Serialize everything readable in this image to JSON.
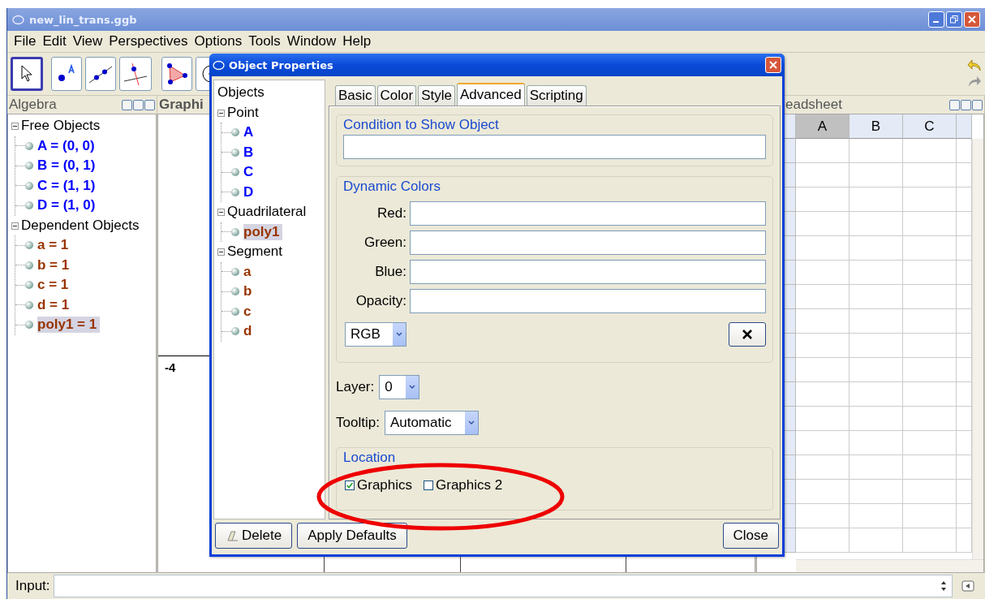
{
  "window": {
    "title": "new_lin_trans.ggb"
  },
  "menu": [
    "File",
    "Edit",
    "View",
    "Perspectives",
    "Options",
    "Tools",
    "Window",
    "Help"
  ],
  "toolbar": [
    {
      "kind": "move",
      "selected": true
    },
    {
      "kind": "point",
      "selected": false
    },
    {
      "kind": "line",
      "selected": false
    },
    {
      "kind": "perpendicular",
      "selected": false
    },
    {
      "kind": "polygon",
      "selected": false
    },
    {
      "kind": "circle",
      "selected": false
    }
  ],
  "algebra": {
    "title": "Algebra",
    "groups": [
      {
        "label": "Free Objects",
        "expanded": true,
        "children": [
          {
            "label": "A = (0, 0)",
            "color": "#0000ff",
            "selected": false
          },
          {
            "label": "B = (0, 1)",
            "color": "#0000ff",
            "selected": false
          },
          {
            "label": "C = (1, 1)",
            "color": "#0000ff",
            "selected": false
          },
          {
            "label": "D = (1, 0)",
            "color": "#0000ff",
            "selected": false
          }
        ]
      },
      {
        "label": "Dependent Objects",
        "expanded": true,
        "children": [
          {
            "label": "a = 1",
            "color": "#993300",
            "selected": false
          },
          {
            "label": "b = 1",
            "color": "#993300",
            "selected": false
          },
          {
            "label": "c = 1",
            "color": "#993300",
            "selected": false
          },
          {
            "label": "d = 1",
            "color": "#993300",
            "selected": false
          },
          {
            "label": "poly1 = 1",
            "color": "#993300",
            "selected": true
          }
        ]
      }
    ]
  },
  "graphics": {
    "title": "Graphi",
    "axis_labels": [
      "-4"
    ]
  },
  "spreadsheet": {
    "title": "eadsheet",
    "columns": [
      {
        "label": "A",
        "selected": true
      },
      {
        "label": "B",
        "selected": false
      },
      {
        "label": "C",
        "selected": false
      }
    ]
  },
  "input": {
    "label": "Input:"
  },
  "dialog": {
    "title": "Object Properties",
    "tree": {
      "label": "Objects",
      "groups": [
        {
          "label": "Point",
          "expanded": true,
          "children": [
            {
              "label": "A",
              "color": "#0000ff",
              "selected": false
            },
            {
              "label": "B",
              "color": "#0000ff",
              "selected": false
            },
            {
              "label": "C",
              "color": "#0000ff",
              "selected": false
            },
            {
              "label": "D",
              "color": "#0000ff",
              "selected": false
            }
          ]
        },
        {
          "label": "Quadrilateral",
          "expanded": true,
          "children": [
            {
              "label": "poly1",
              "color": "#993300",
              "selected": true
            }
          ]
        },
        {
          "label": "Segment",
          "expanded": true,
          "children": [
            {
              "label": "a",
              "color": "#993300",
              "selected": false
            },
            {
              "label": "b",
              "color": "#993300",
              "selected": false
            },
            {
              "label": "c",
              "color": "#993300",
              "selected": false
            },
            {
              "label": "d",
              "color": "#993300",
              "selected": false
            }
          ]
        }
      ]
    },
    "tabs": [
      {
        "label": "Basic",
        "selected": false
      },
      {
        "label": "Color",
        "selected": false
      },
      {
        "label": "Style",
        "selected": false
      },
      {
        "label": "Advanced",
        "selected": true
      },
      {
        "label": "Scripting",
        "selected": false
      }
    ],
    "condition": {
      "title": "Condition to Show Object"
    },
    "dynamic_colors": {
      "title": "Dynamic Colors",
      "fields": [
        {
          "label": "Red:"
        },
        {
          "label": "Green:"
        },
        {
          "label": "Blue:"
        },
        {
          "label": "Opacity:"
        }
      ],
      "mode": "RGB"
    },
    "layer": {
      "label": "Layer:",
      "value": "0"
    },
    "tooltip": {
      "label": "Tooltip:",
      "value": "Automatic"
    },
    "location": {
      "title": "Location",
      "options": [
        {
          "label": "Graphics",
          "checked": true
        },
        {
          "label": "Graphics 2",
          "checked": false
        }
      ]
    },
    "buttons": [
      {
        "label": "Delete",
        "kind": "delete"
      },
      {
        "label": "Apply Defaults",
        "kind": "plain"
      },
      {
        "label": "Close",
        "kind": "close"
      }
    ]
  },
  "annotation": {
    "kind": "ellipse"
  }
}
